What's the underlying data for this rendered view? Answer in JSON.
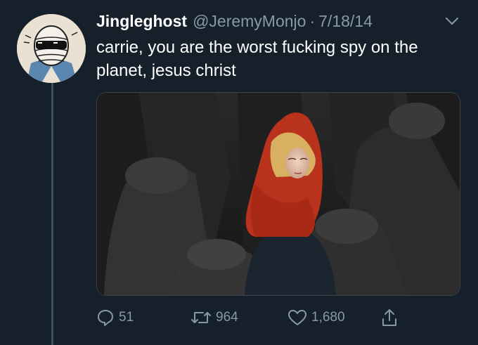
{
  "tweet": {
    "display_name": "Jingleghost",
    "handle": "@JeremyMonjo",
    "separator": "·",
    "date": "7/18/14",
    "text": "carrie, you are the worst fucking spy on the planet, jesus christ",
    "avatar_icon": "masked-comic-character-avatar",
    "media_icon": "tv-still-red-headscarf-woman-among-burqas"
  },
  "actions": {
    "reply_count": "51",
    "retweet_count": "964",
    "like_count": "1,680",
    "icons": [
      "reply-icon",
      "retweet-icon",
      "like-icon",
      "share-icon"
    ]
  },
  "colors": {
    "background": "#15202b",
    "text": "#ffffff",
    "secondary": "#8899a6",
    "thread_line": "#3d5466"
  }
}
